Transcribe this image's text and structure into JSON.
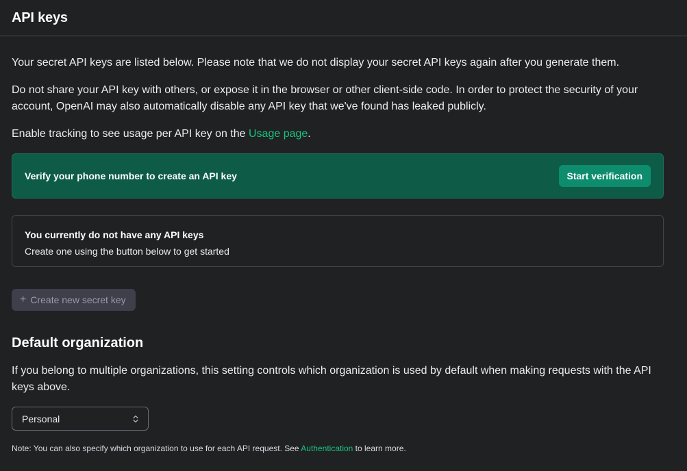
{
  "header": {
    "title": "API keys"
  },
  "intro": {
    "p1": "Your secret API keys are listed below. Please note that we do not display your secret API keys again after you generate them.",
    "p2": "Do not share your API key with others, or expose it in the browser or other client-side code. In order to protect the security of your account, OpenAI may also automatically disable any API key that we've found has leaked publicly.",
    "p3_prefix": "Enable tracking to see usage per API key on the ",
    "p3_link": "Usage page",
    "p3_suffix": "."
  },
  "verify": {
    "text": "Verify your phone number to create an API key",
    "button": "Start verification"
  },
  "empty_state": {
    "title": "You currently do not have any API keys",
    "subtitle": "Create one using the button below to get started"
  },
  "create_button": {
    "icon": "plus-icon",
    "label": "Create new secret key"
  },
  "default_org": {
    "title": "Default organization",
    "description": "If you belong to multiple organizations, this setting controls which organization is used by default when making requests with the API keys above.",
    "selected": "Personal",
    "note_prefix": "Note: You can also specify which organization to use for each API request. See ",
    "note_link": "Authentication",
    "note_suffix": " to learn more."
  },
  "colors": {
    "background": "#202123",
    "accent": "#19c37d",
    "verify_card": "#0e5c48",
    "verify_button": "#0d8d6d"
  }
}
